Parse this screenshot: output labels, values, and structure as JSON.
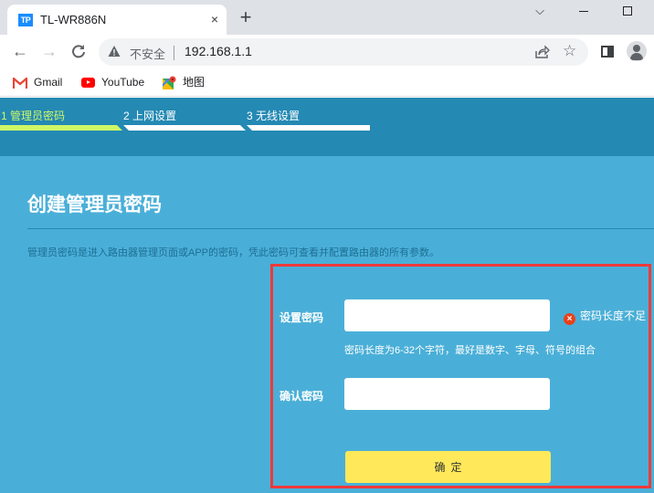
{
  "browser": {
    "tab": {
      "favicon_text": "TP",
      "title": "TL-WR886N",
      "close_glyph": "×"
    },
    "new_tab_glyph": "+",
    "window_controls": {
      "tab_search_glyph": "⌵",
      "minimize": "",
      "maximize": ""
    },
    "nav": {
      "back_glyph": "←",
      "forward_glyph": "→",
      "reload_glyph": "C"
    },
    "omnibox": {
      "security_label": "不安全",
      "url": "192.168.1.1"
    },
    "star_glyph": "☆",
    "bookmarks": [
      {
        "label": "Gmail",
        "icon": "gmail-icon"
      },
      {
        "label": "YouTube",
        "icon": "youtube-icon"
      },
      {
        "label": "地图",
        "icon": "maps-icon"
      }
    ]
  },
  "router": {
    "steps": [
      {
        "label": "1 管理员密码",
        "active": true
      },
      {
        "label": "2 上网设置",
        "active": false
      },
      {
        "label": "3 无线设置",
        "active": false
      }
    ],
    "page_title": "创建管理员密码",
    "description": "管理员密码是进入路由器管理页面或APP的密码，凭此密码可查看并配置路由器的所有参数。",
    "form": {
      "password_label": "设置密码",
      "password_value": "",
      "error_icon_glyph": "×",
      "error_text": "密码长度不足",
      "hint": "密码长度为6-32个字符，最好是数字、字母、符号的组合",
      "confirm_label": "确认密码",
      "confirm_value": "",
      "submit_label": "确定"
    },
    "colors": {
      "header": "#2489b3",
      "background": "#4aafd8",
      "active_step": "#cff766",
      "button": "#ffe95a",
      "highlight_border": "#f0393a",
      "error_icon": "#e8411b"
    }
  }
}
